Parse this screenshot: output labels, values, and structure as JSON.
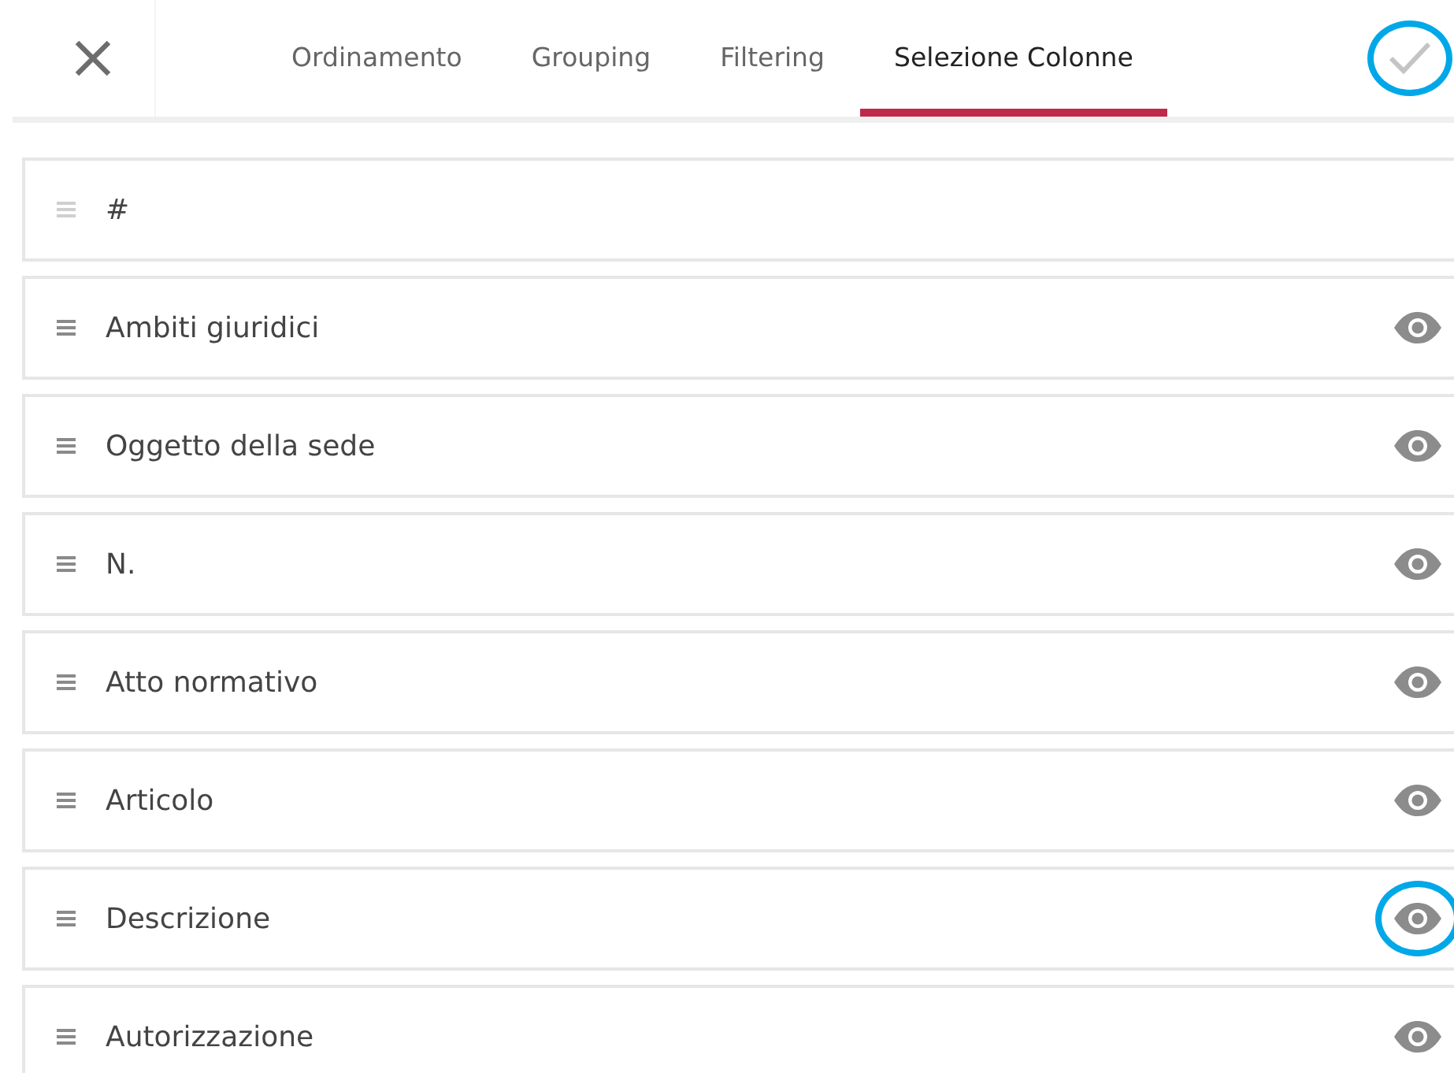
{
  "tabs": [
    {
      "label": "Ordinamento",
      "selected": false
    },
    {
      "label": "Grouping",
      "selected": false
    },
    {
      "label": "Filtering",
      "selected": false
    },
    {
      "label": "Selezione Colonne",
      "selected": true
    }
  ],
  "confirm": {
    "highlighted": true
  },
  "columns": [
    {
      "label": "#",
      "locked": true
    },
    {
      "label": "Ambiti giuridici",
      "locked": false,
      "highlighted": false
    },
    {
      "label": "Oggetto della sede",
      "locked": false,
      "highlighted": false
    },
    {
      "label": "N.",
      "locked": false,
      "highlighted": false
    },
    {
      "label": "Atto normativo",
      "locked": false,
      "highlighted": false
    },
    {
      "label": "Articolo",
      "locked": false,
      "highlighted": false
    },
    {
      "label": "Descrizione",
      "locked": false,
      "highlighted": true
    },
    {
      "label": "Autorizzazione",
      "locked": false,
      "highlighted": false
    }
  ]
}
